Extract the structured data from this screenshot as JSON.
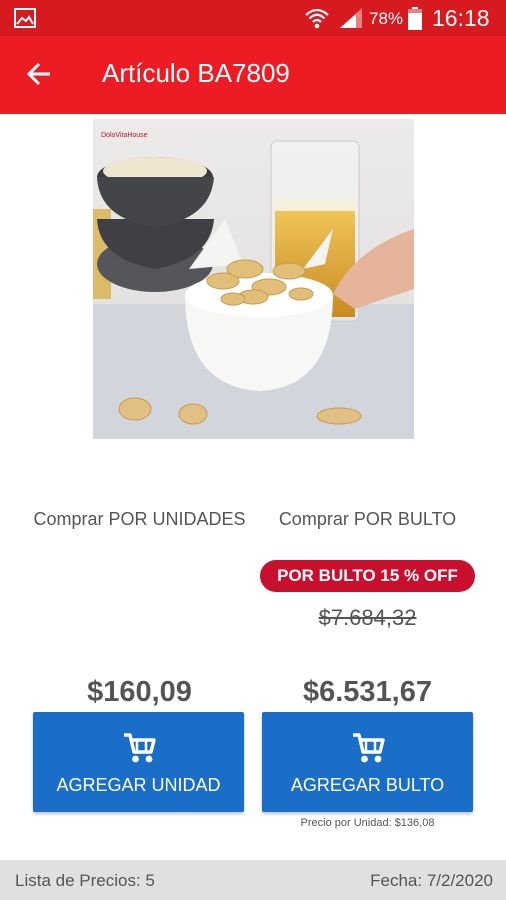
{
  "status_bar": {
    "battery_percent": "78%",
    "time": "16:18",
    "icons": [
      "gallery-icon",
      "wifi-icon",
      "signal-icon",
      "battery-icon"
    ]
  },
  "app_bar": {
    "title": "Artículo BA7809",
    "back_icon": "arrow-back-icon"
  },
  "product": {
    "image_logo_text": "DoloVitaHouse"
  },
  "unit_option": {
    "label": "Comprar POR UNIDADES",
    "price": "$160,09",
    "button_label": "AGREGAR UNIDAD"
  },
  "bulk_option": {
    "label": "Comprar POR BULTO",
    "badge": "POR BULTO 15 % OFF",
    "old_price": "$7.684,32",
    "price": "$6.531,67",
    "button_label": "AGREGAR BULTO",
    "unit_price_note": "Precio por Unidad: $136,08"
  },
  "footer": {
    "price_list": "Lista de Precios: 5",
    "date": "Fecha: 7/2/2020"
  },
  "colors": {
    "status_bar": "#d71920",
    "app_bar": "#ed1c24",
    "badge": "#c8102e",
    "button": "#1a6ec7",
    "footer": "#e0e0e0"
  }
}
